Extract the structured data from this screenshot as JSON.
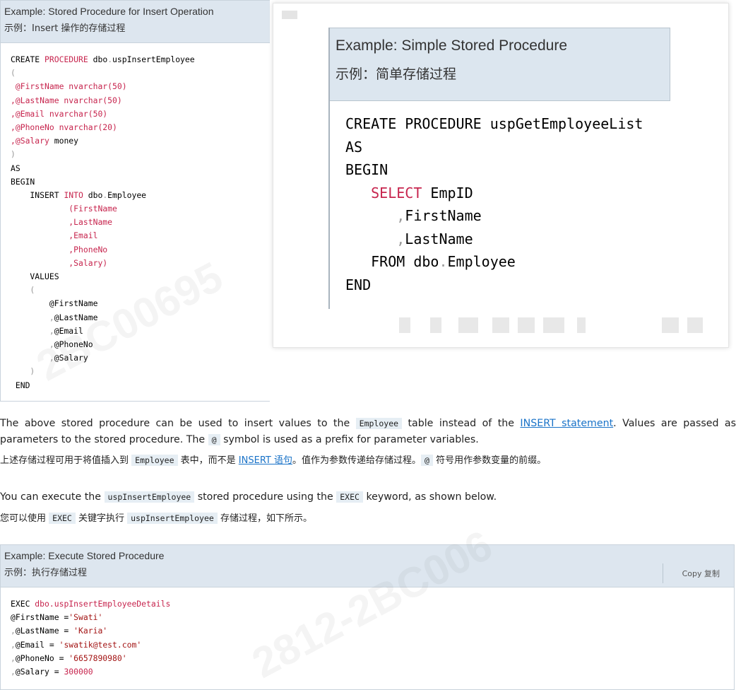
{
  "box1": {
    "title": "Example: Stored Procedure for Insert Operation",
    "subtitle": "示例：Insert 操作的存储过程",
    "code": [
      [
        {
          "t": "CREATE ",
          "c": ""
        },
        {
          "t": "PROCEDURE",
          "c": "kw"
        },
        {
          "t": " dbo",
          "c": ""
        },
        {
          "t": ".",
          "c": "pu"
        },
        {
          "t": "uspInsertEmployee",
          "c": ""
        }
      ],
      [
        {
          "t": "(",
          "c": "pu"
        }
      ],
      [
        {
          "t": " @FirstName nvarchar(50)",
          "c": "kw"
        }
      ],
      [
        {
          "t": ",@LastName nvarchar(50)",
          "c": "kw"
        }
      ],
      [
        {
          "t": ",@Email nvarchar(50)",
          "c": "kw"
        }
      ],
      [
        {
          "t": ",@PhoneNo nvarchar(20)",
          "c": "kw"
        }
      ],
      [
        {
          "t": ",@",
          "c": "kw"
        },
        {
          "t": "Salary",
          "c": "kw"
        },
        {
          "t": " money",
          "c": ""
        }
      ],
      [
        {
          "t": ")",
          "c": "pu"
        }
      ],
      [
        {
          "t": "AS",
          "c": ""
        }
      ],
      [
        {
          "t": "BEGIN",
          "c": ""
        }
      ],
      [
        {
          "t": "    INSERT ",
          "c": ""
        },
        {
          "t": "INTO",
          "c": "kw"
        },
        {
          "t": " dbo",
          "c": ""
        },
        {
          "t": ".",
          "c": "pu"
        },
        {
          "t": "Employee",
          "c": ""
        }
      ],
      [
        {
          "t": "            (FirstName",
          "c": "kw"
        }
      ],
      [
        {
          "t": "            ,LastName",
          "c": "kw"
        }
      ],
      [
        {
          "t": "            ,Email",
          "c": "kw"
        }
      ],
      [
        {
          "t": "            ,PhoneNo",
          "c": "kw"
        }
      ],
      [
        {
          "t": "            ,Salary)",
          "c": "kw"
        }
      ],
      [
        {
          "t": "    VALUES",
          "c": ""
        }
      ],
      [
        {
          "t": "    (",
          "c": "pu"
        }
      ],
      [
        {
          "t": "        @FirstName",
          "c": ""
        }
      ],
      [
        {
          "t": "        ,",
          "c": "pu"
        },
        {
          "t": "@LastName",
          "c": ""
        }
      ],
      [
        {
          "t": "        ,",
          "c": "pu"
        },
        {
          "t": "@Email",
          "c": ""
        }
      ],
      [
        {
          "t": "        ,",
          "c": "pu"
        },
        {
          "t": "@PhoneNo",
          "c": ""
        }
      ],
      [
        {
          "t": "        ,",
          "c": "pu"
        },
        {
          "t": "@Salary",
          "c": ""
        }
      ],
      [
        {
          "t": "    )",
          "c": "pu"
        }
      ],
      [
        {
          "t": " END",
          "c": ""
        }
      ]
    ]
  },
  "overlay": {
    "title": "Example: Simple Stored Procedure",
    "subtitle": "示例：简单存储过程",
    "code": [
      [
        {
          "t": "CREATE PROCEDURE uspGetEmployeeList",
          "c": ""
        }
      ],
      [
        {
          "t": "AS",
          "c": ""
        }
      ],
      [
        {
          "t": "BEGIN",
          "c": ""
        }
      ],
      [
        {
          "t": "   ",
          "c": ""
        },
        {
          "t": "SELECT",
          "c": "kw"
        },
        {
          "t": " EmpID",
          "c": ""
        }
      ],
      [
        {
          "t": "      ,",
          "c": "pu"
        },
        {
          "t": "FirstName",
          "c": ""
        }
      ],
      [
        {
          "t": "      ,",
          "c": "pu"
        },
        {
          "t": "LastName",
          "c": ""
        }
      ],
      [
        {
          "t": "   FROM dbo",
          "c": ""
        },
        {
          "t": ".",
          "c": "pu"
        },
        {
          "t": "Employee",
          "c": ""
        }
      ],
      [
        {
          "t": "END",
          "c": ""
        }
      ]
    ]
  },
  "para1": {
    "en_1": "The above stored procedure can be used to insert values to the ",
    "en_code1": "Employee",
    "en_2": " table instead of the ",
    "en_link": "INSERT statement",
    "en_3": ". Values are passed as parameters to the stored procedure. The ",
    "en_code2": "@",
    "en_4": " symbol is used as a prefix for parameter variables.",
    "zh_1": "上述存储过程可用于将值插入到 ",
    "zh_code1": "Employee",
    "zh_2": " 表中，而不是 ",
    "zh_link": "INSERT 语句",
    "zh_3": "。值作为参数传递给存储过程。",
    "zh_code2": "@",
    "zh_4": " 符号用作参数变量的前缀。"
  },
  "para2": {
    "en_1": "You can execute the ",
    "en_code1": "uspInsertEmployee",
    "en_2": " stored procedure using the ",
    "en_code2": "EXEC",
    "en_3": " keyword, as shown below.",
    "zh_1": "您可以使用 ",
    "zh_code1": "EXEC",
    "zh_2": " 关键字执行 ",
    "zh_code2": "uspInsertEmployee",
    "zh_3": " 存储过程，如下所示。"
  },
  "box2": {
    "title": "Example: Execute Stored Procedure",
    "subtitle": "示例：执行存储过程",
    "copy_label": "Copy  复制",
    "code": [
      [
        {
          "t": "EXEC ",
          "c": ""
        },
        {
          "t": "dbo.uspInsertEmployeeDetails",
          "c": "kw"
        }
      ],
      [
        {
          "t": "@FirstName =",
          "c": ""
        },
        {
          "t": "'Swati'",
          "c": "str"
        }
      ],
      [
        {
          "t": ",",
          "c": "pu"
        },
        {
          "t": "@LastName = ",
          "c": ""
        },
        {
          "t": "'Karia'",
          "c": "str"
        }
      ],
      [
        {
          "t": ",",
          "c": "pu"
        },
        {
          "t": "@Email = ",
          "c": ""
        },
        {
          "t": "'swatik@test.com'",
          "c": "str"
        }
      ],
      [
        {
          "t": ",",
          "c": "pu"
        },
        {
          "t": "@PhoneNo = ",
          "c": ""
        },
        {
          "t": "'6657890980'",
          "c": "str"
        }
      ],
      [
        {
          "t": ",",
          "c": "pu"
        },
        {
          "t": "@Salary = ",
          "c": ""
        },
        {
          "t": "300000",
          "c": "kw"
        }
      ]
    ]
  },
  "colors": {
    "header_bg": "#dde6ef",
    "keyword": "#c7254e",
    "string": "#a31515",
    "link": "#1a73c8"
  }
}
